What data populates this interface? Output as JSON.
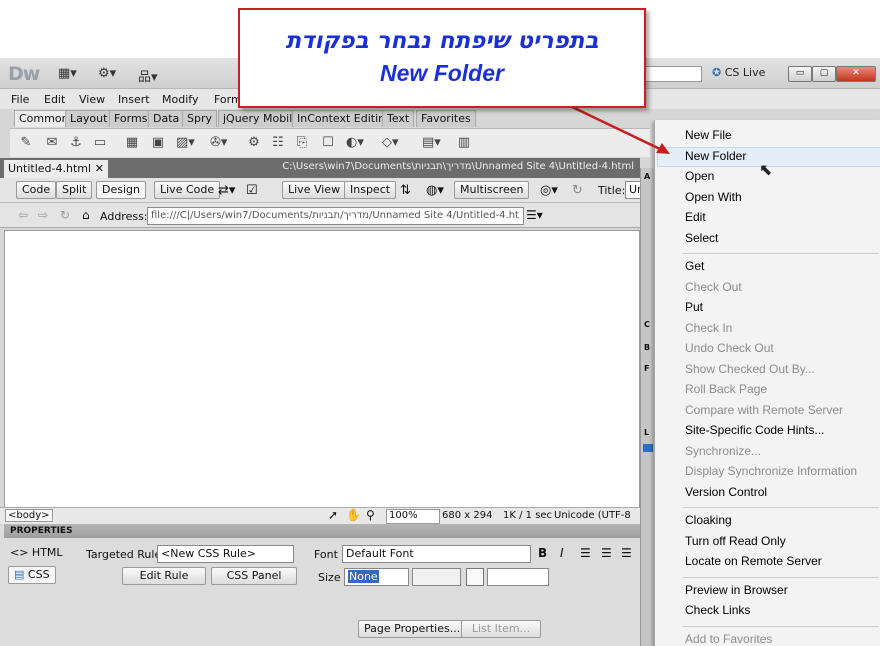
{
  "app": {
    "logo": "Dw",
    "cs_live": "CS Live",
    "win_buttons": [
      "▭",
      "▢",
      "✕"
    ]
  },
  "menubar": [
    "File",
    "Edit",
    "View",
    "Insert",
    "Modify",
    "Form"
  ],
  "insert_tabs": [
    "Common",
    "Layout",
    "Forms",
    "Data",
    "Spry",
    "jQuery Mobile",
    "InContext Editing",
    "Text",
    "Favorites"
  ],
  "document": {
    "tab_name": "Untitled-4.html",
    "tab_close": "✕",
    "path": "C:\\Users\\win7\\Documents\\מדריך\\תבניות\\Unnamed Site 4\\Untitled-4.html"
  },
  "doc_toolbar": {
    "code": "Code",
    "split": "Split",
    "design": "Design",
    "live_code": "Live Code",
    "live_view": "Live View",
    "inspect": "Inspect",
    "multiscreen": "Multiscreen",
    "title_label": "Title:",
    "title_value": "Ur"
  },
  "address_bar": {
    "label": "Address:",
    "value": "file:///C|/Users/win7/Documents/מדריך/תבניות/Unnamed Site 4/Untitled-4.ht"
  },
  "status_bar": {
    "tag": "<body>",
    "zoom": "100%",
    "dims": "680 x 294",
    "size": "1K / 1 sec",
    "encoding": "Unicode (UTF-8"
  },
  "properties": {
    "title": "PROPERTIES",
    "html_btn": "<> HTML",
    "css_btn": "CSS",
    "targeted_rule_label": "Targeted Rule",
    "targeted_rule_value": "<New CSS Rule>",
    "edit_rule": "Edit Rule",
    "css_panel": "CSS Panel",
    "font_label": "Font",
    "font_value": "Default Font",
    "size_label": "Size",
    "size_value": "None",
    "page_properties": "Page Properties...",
    "list_item": "List Item..."
  },
  "side_letters": [
    "A",
    "C",
    "B",
    "F",
    "L"
  ],
  "context_menu": {
    "highlighted": "New Folder",
    "groups": [
      [
        {
          "label": "New File",
          "enabled": true
        },
        {
          "label": "New Folder",
          "enabled": true
        },
        {
          "label": "Open",
          "enabled": true
        },
        {
          "label": "Open With",
          "enabled": true
        },
        {
          "label": "Edit",
          "enabled": true
        },
        {
          "label": "Select",
          "enabled": true
        }
      ],
      [
        {
          "label": "Get",
          "enabled": true
        },
        {
          "label": "Check Out",
          "enabled": false
        },
        {
          "label": "Put",
          "enabled": true
        },
        {
          "label": "Check In",
          "enabled": false
        },
        {
          "label": "Undo Check Out",
          "enabled": false
        },
        {
          "label": "Show Checked Out By...",
          "enabled": false
        },
        {
          "label": "Roll Back Page",
          "enabled": false
        },
        {
          "label": "Compare with Remote Server",
          "enabled": false
        },
        {
          "label": "Site-Specific Code Hints...",
          "enabled": true
        },
        {
          "label": "Synchronize...",
          "enabled": false
        },
        {
          "label": "Display Synchronize Information",
          "enabled": false
        },
        {
          "label": "Version Control",
          "enabled": true
        }
      ],
      [
        {
          "label": "Cloaking",
          "enabled": true
        },
        {
          "label": "Turn off Read Only",
          "enabled": true
        },
        {
          "label": "Locate on Remote Server",
          "enabled": true
        }
      ],
      [
        {
          "label": "Preview in Browser",
          "enabled": true
        },
        {
          "label": "Check Links",
          "enabled": true
        }
      ],
      [
        {
          "label": "Add to Favorites",
          "enabled": false
        }
      ]
    ]
  },
  "callout": {
    "line1": "בתפריט שיפתח נבחר בפקודת",
    "line2": "New Folder"
  }
}
